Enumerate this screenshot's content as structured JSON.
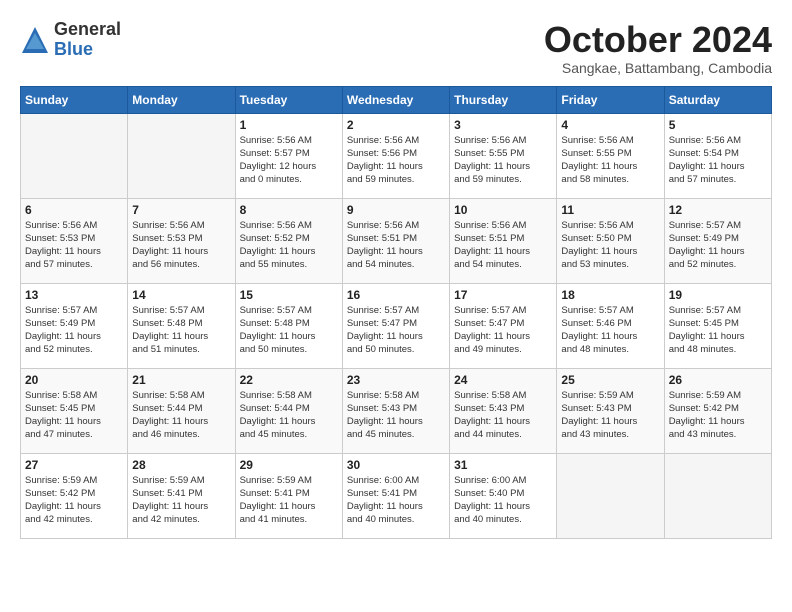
{
  "header": {
    "logo_line1": "General",
    "logo_line2": "Blue",
    "month": "October 2024",
    "location": "Sangkae, Battambang, Cambodia"
  },
  "weekdays": [
    "Sunday",
    "Monday",
    "Tuesday",
    "Wednesday",
    "Thursday",
    "Friday",
    "Saturday"
  ],
  "weeks": [
    [
      {
        "day": "",
        "info": ""
      },
      {
        "day": "",
        "info": ""
      },
      {
        "day": "1",
        "info": "Sunrise: 5:56 AM\nSunset: 5:57 PM\nDaylight: 12 hours\nand 0 minutes."
      },
      {
        "day": "2",
        "info": "Sunrise: 5:56 AM\nSunset: 5:56 PM\nDaylight: 11 hours\nand 59 minutes."
      },
      {
        "day": "3",
        "info": "Sunrise: 5:56 AM\nSunset: 5:55 PM\nDaylight: 11 hours\nand 59 minutes."
      },
      {
        "day": "4",
        "info": "Sunrise: 5:56 AM\nSunset: 5:55 PM\nDaylight: 11 hours\nand 58 minutes."
      },
      {
        "day": "5",
        "info": "Sunrise: 5:56 AM\nSunset: 5:54 PM\nDaylight: 11 hours\nand 57 minutes."
      }
    ],
    [
      {
        "day": "6",
        "info": "Sunrise: 5:56 AM\nSunset: 5:53 PM\nDaylight: 11 hours\nand 57 minutes."
      },
      {
        "day": "7",
        "info": "Sunrise: 5:56 AM\nSunset: 5:53 PM\nDaylight: 11 hours\nand 56 minutes."
      },
      {
        "day": "8",
        "info": "Sunrise: 5:56 AM\nSunset: 5:52 PM\nDaylight: 11 hours\nand 55 minutes."
      },
      {
        "day": "9",
        "info": "Sunrise: 5:56 AM\nSunset: 5:51 PM\nDaylight: 11 hours\nand 54 minutes."
      },
      {
        "day": "10",
        "info": "Sunrise: 5:56 AM\nSunset: 5:51 PM\nDaylight: 11 hours\nand 54 minutes."
      },
      {
        "day": "11",
        "info": "Sunrise: 5:56 AM\nSunset: 5:50 PM\nDaylight: 11 hours\nand 53 minutes."
      },
      {
        "day": "12",
        "info": "Sunrise: 5:57 AM\nSunset: 5:49 PM\nDaylight: 11 hours\nand 52 minutes."
      }
    ],
    [
      {
        "day": "13",
        "info": "Sunrise: 5:57 AM\nSunset: 5:49 PM\nDaylight: 11 hours\nand 52 minutes."
      },
      {
        "day": "14",
        "info": "Sunrise: 5:57 AM\nSunset: 5:48 PM\nDaylight: 11 hours\nand 51 minutes."
      },
      {
        "day": "15",
        "info": "Sunrise: 5:57 AM\nSunset: 5:48 PM\nDaylight: 11 hours\nand 50 minutes."
      },
      {
        "day": "16",
        "info": "Sunrise: 5:57 AM\nSunset: 5:47 PM\nDaylight: 11 hours\nand 50 minutes."
      },
      {
        "day": "17",
        "info": "Sunrise: 5:57 AM\nSunset: 5:47 PM\nDaylight: 11 hours\nand 49 minutes."
      },
      {
        "day": "18",
        "info": "Sunrise: 5:57 AM\nSunset: 5:46 PM\nDaylight: 11 hours\nand 48 minutes."
      },
      {
        "day": "19",
        "info": "Sunrise: 5:57 AM\nSunset: 5:45 PM\nDaylight: 11 hours\nand 48 minutes."
      }
    ],
    [
      {
        "day": "20",
        "info": "Sunrise: 5:58 AM\nSunset: 5:45 PM\nDaylight: 11 hours\nand 47 minutes."
      },
      {
        "day": "21",
        "info": "Sunrise: 5:58 AM\nSunset: 5:44 PM\nDaylight: 11 hours\nand 46 minutes."
      },
      {
        "day": "22",
        "info": "Sunrise: 5:58 AM\nSunset: 5:44 PM\nDaylight: 11 hours\nand 45 minutes."
      },
      {
        "day": "23",
        "info": "Sunrise: 5:58 AM\nSunset: 5:43 PM\nDaylight: 11 hours\nand 45 minutes."
      },
      {
        "day": "24",
        "info": "Sunrise: 5:58 AM\nSunset: 5:43 PM\nDaylight: 11 hours\nand 44 minutes."
      },
      {
        "day": "25",
        "info": "Sunrise: 5:59 AM\nSunset: 5:43 PM\nDaylight: 11 hours\nand 43 minutes."
      },
      {
        "day": "26",
        "info": "Sunrise: 5:59 AM\nSunset: 5:42 PM\nDaylight: 11 hours\nand 43 minutes."
      }
    ],
    [
      {
        "day": "27",
        "info": "Sunrise: 5:59 AM\nSunset: 5:42 PM\nDaylight: 11 hours\nand 42 minutes."
      },
      {
        "day": "28",
        "info": "Sunrise: 5:59 AM\nSunset: 5:41 PM\nDaylight: 11 hours\nand 42 minutes."
      },
      {
        "day": "29",
        "info": "Sunrise: 5:59 AM\nSunset: 5:41 PM\nDaylight: 11 hours\nand 41 minutes."
      },
      {
        "day": "30",
        "info": "Sunrise: 6:00 AM\nSunset: 5:41 PM\nDaylight: 11 hours\nand 40 minutes."
      },
      {
        "day": "31",
        "info": "Sunrise: 6:00 AM\nSunset: 5:40 PM\nDaylight: 11 hours\nand 40 minutes."
      },
      {
        "day": "",
        "info": ""
      },
      {
        "day": "",
        "info": ""
      }
    ]
  ]
}
